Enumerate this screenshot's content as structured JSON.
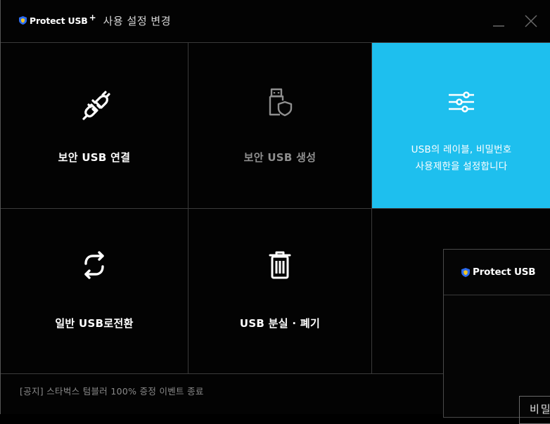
{
  "titlebar": {
    "brand": "Protect USB",
    "brand_plus": "+",
    "title": "사용 설정 변경",
    "minimize_label": "_",
    "close_label": "X"
  },
  "colors": {
    "accent": "#1ebfee",
    "background": "#030303",
    "shield_blue": "#2d6cf0",
    "shield_yellow": "#f3c623",
    "notice_text": "#8a8a8a",
    "disabled_text": "#8f8f8f"
  },
  "tiles": [
    {
      "icon": "plug-connect-icon",
      "label": "보안 USB 연결",
      "state": "normal"
    },
    {
      "icon": "usb-shield-icon",
      "label": "보안 USB 생성",
      "state": "disabled"
    },
    {
      "icon": "sliders-icon",
      "label": "",
      "state": "active",
      "description_line1": "USB의 레이블, 비밀번호",
      "description_line2": "사용제한을 설정합니다"
    },
    {
      "icon": "refresh-icon",
      "label": "일반 USB로전환",
      "state": "normal"
    },
    {
      "icon": "trash-icon",
      "label": "USB 분실 · 폐기",
      "state": "normal"
    }
  ],
  "notice": "[공지] 스타벅스 텀블러 100% 증정 이벤트 종료",
  "popup": {
    "brand": "Protect USB",
    "field_text": "비밀"
  }
}
